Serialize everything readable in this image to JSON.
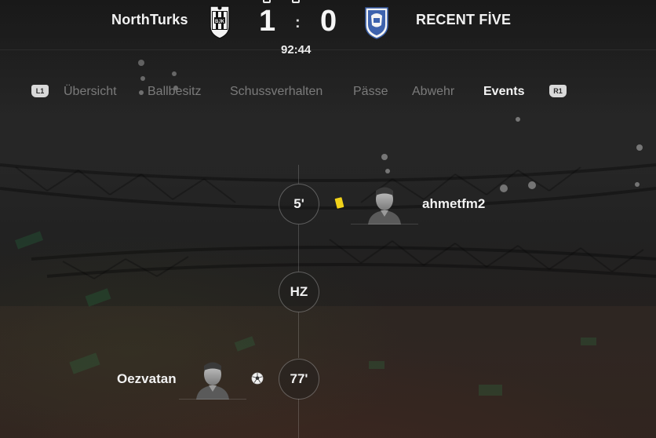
{
  "scoreboard": {
    "home_team": "NorthTurks",
    "away_team": "RECENT FİVE",
    "home_score": "1",
    "away_score": "0",
    "separator": ":",
    "match_clock": "92:44",
    "home_crest": "besiktas-crest-icon",
    "away_crest": "blue-white-shield-crest-icon"
  },
  "tabs": {
    "left_bumper": "L1",
    "right_bumper": "R1",
    "items": [
      {
        "label": "Übersicht",
        "active": false
      },
      {
        "label": "Ballbesitz",
        "active": false
      },
      {
        "label": "Schussverhalten",
        "active": false
      },
      {
        "label": "Pässe",
        "active": false
      },
      {
        "label": "Abwehr",
        "active": false
      },
      {
        "label": "Events",
        "active": true
      }
    ]
  },
  "events": [
    {
      "minute": "5'",
      "side": "away",
      "player": "ahmetfm2",
      "icon": "yellow-card-icon"
    },
    {
      "minute": "HZ",
      "side": "none",
      "player": "",
      "icon": ""
    },
    {
      "minute": "77'",
      "side": "home",
      "player": "Oezvatan",
      "icon": "football-goal-icon"
    }
  ],
  "colors": {
    "yellow_card": "#f1d21a",
    "active_tab": "#f4f4f4",
    "inactive_tab": "#7b7b7b"
  }
}
